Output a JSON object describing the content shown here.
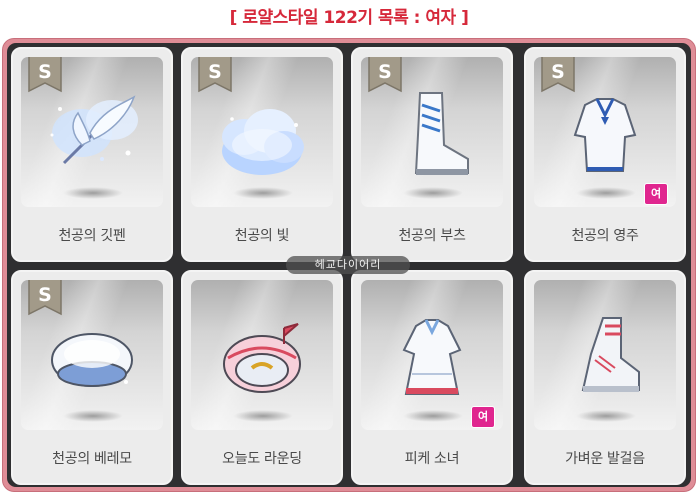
{
  "title": "[ 로얄스타일 122기 목록 : 여자 ]",
  "watermark": "헤교다이어리",
  "items": [
    {
      "name": "천공의 깃펜",
      "badge": "S",
      "gender": "",
      "icon": "quill-pen-icon"
    },
    {
      "name": "천공의 빛",
      "badge": "S",
      "gender": "",
      "icon": "sky-light-cloud-icon"
    },
    {
      "name": "천공의 부츠",
      "badge": "S",
      "gender": "",
      "icon": "white-boots-icon"
    },
    {
      "name": "천공의 영주",
      "badge": "S",
      "gender": "여",
      "icon": "sailor-dress-icon"
    },
    {
      "name": "천공의 베레모",
      "badge": "S",
      "gender": "",
      "icon": "beret-hat-icon"
    },
    {
      "name": "오늘도 라운딩",
      "badge": "",
      "gender": "",
      "icon": "golf-cap-icon"
    },
    {
      "name": "피케 소녀",
      "badge": "",
      "gender": "여",
      "icon": "pique-dress-icon"
    },
    {
      "name": "가벼운 발걸음",
      "badge": "",
      "gender": "",
      "icon": "sneakers-icon"
    }
  ],
  "colors": {
    "title": "#d6283a",
    "frame": "#df8d97",
    "grid_background": "#2f2f31",
    "badge": "#a29a89",
    "gender_badge": "#e0268f"
  }
}
